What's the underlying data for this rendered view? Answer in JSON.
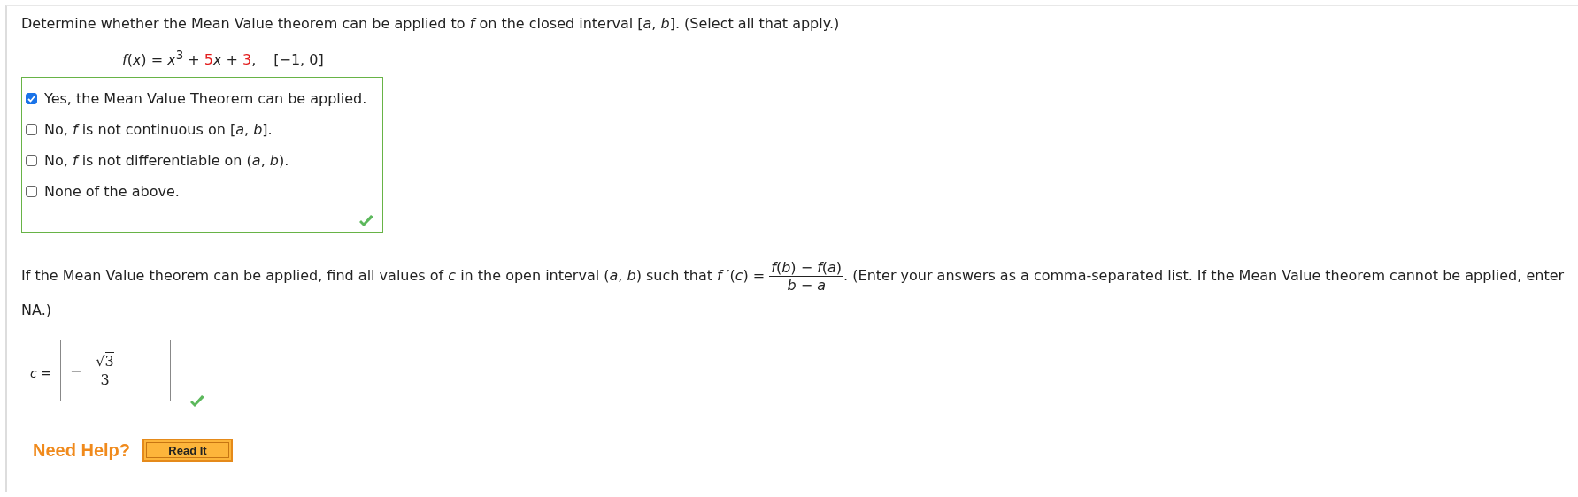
{
  "question": "Determine whether the Mean Value theorem can be applied to *f* on the closed interval [*a*, *b*]. (Select all that apply.)",
  "formula": {
    "parts": [
      {
        "text": "*f*(*x*) = *x*$^{3}$ + ",
        "highlighted": false
      },
      {
        "text": "5",
        "highlighted": true
      },
      {
        "text": "*x* + ",
        "highlighted": false
      },
      {
        "text": "3",
        "highlighted": true
      },
      {
        "text": ",",
        "highlighted": false
      }
    ],
    "interval": "[−1, 0]"
  },
  "options": {
    "correct": true,
    "items": [
      {
        "label": "Yes, the Mean Value Theorem can be applied.",
        "checked": true
      },
      {
        "label": "No, *f* is not continuous on [*a*, *b*].",
        "checked": false
      },
      {
        "label": "No, *f* is not differentiable on (*a*, *b*).",
        "checked": false
      },
      {
        "label": "None of the above.",
        "checked": false
      }
    ]
  },
  "part2": {
    "before": "If the Mean Value theorem can be applied, find all values of *c* in the open interval (*a*, *b*) such that *f* ′(*c*) = ",
    "numerator": "*f*(*b*) − *f*(*a*)",
    "denominator": "*b* − *a*",
    "after": ". (Enter your answers as a comma-separated list. If the Mean Value theorem cannot be applied, enter NA.)"
  },
  "answer": {
    "label": "*c* =",
    "sign": "−",
    "radical": "√",
    "radicand": "3",
    "denominator": "3",
    "correct": true
  },
  "help": {
    "label": "Need Help?",
    "button": "Read It"
  }
}
